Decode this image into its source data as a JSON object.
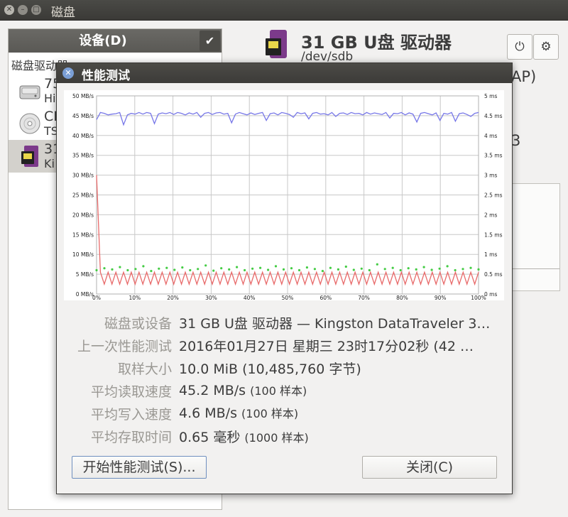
{
  "window": {
    "title": "磁盘"
  },
  "sidebar": {
    "header": "设备(D)",
    "group_label": "磁盘驱动器",
    "items": [
      {
        "name": "75",
        "sub": "Hi",
        "icon": "hard-disk-icon"
      },
      {
        "name": "CI",
        "sub": "TS",
        "icon": "optical-disc-icon"
      },
      {
        "name": "31",
        "sub": "Ki",
        "icon": "usb-drive-icon"
      }
    ]
  },
  "drive": {
    "title": "31 GB U盘 驱动器",
    "path": "/dev/sdb",
    "partial_1": "AP)",
    "partial_2": "3"
  },
  "dialog": {
    "title": "性能测试",
    "rows": [
      {
        "label": "磁盘或设备",
        "value": "31 GB U盘 驱动器 — Kingston DataTraveler 3…",
        "note": ""
      },
      {
        "label": "上一次性能测试",
        "value": "2016年01月27日 星期三 23时17分02秒 (42 …",
        "note": ""
      },
      {
        "label": "取样大小",
        "value": "10.0 MiB (10,485,760 字节)",
        "note": ""
      },
      {
        "label": "平均读取速度",
        "value": "45.2 MB/s",
        "note": "(100 样本)"
      },
      {
        "label": "平均写入速度",
        "value": "4.6 MB/s",
        "note": "(100 样本)"
      },
      {
        "label": "平均存取时间",
        "value": "0.65 毫秒",
        "note": "(1000 样本)"
      }
    ],
    "start_button": "开始性能测试(S)...",
    "close_button": "关闭(C)"
  },
  "chart_data": {
    "type": "line",
    "left_ticks": [
      "0 MB/s",
      "5 MB/s",
      "10 MB/s",
      "15 MB/s",
      "20 MB/s",
      "25 MB/s",
      "30 MB/s",
      "35 MB/s",
      "40 MB/s",
      "45 MB/s",
      "50 MB/s"
    ],
    "right_ticks": [
      "0 ms",
      "0.5 ms",
      "1 ms",
      "1.5 ms",
      "2 ms",
      "2.5 ms",
      "3 ms",
      "3.5 ms",
      "4 ms",
      "4.5 ms",
      "5 ms"
    ],
    "x_ticks": [
      "0%",
      "10%",
      "20%",
      "30%",
      "40%",
      "50%",
      "60%",
      "70%",
      "80%",
      "90%",
      "100%"
    ],
    "ylim_left": [
      0,
      50
    ],
    "ylim_right": [
      0,
      5
    ],
    "xlim": [
      0,
      100
    ],
    "grid": true,
    "colors": {
      "read": "#7777e8",
      "write": "#e86a6a",
      "access": "#44cc44"
    },
    "series": [
      {
        "values": [
          44,
          45.8,
          45.6,
          45.2,
          45.4,
          45.5,
          45.8,
          42.7,
          45.2,
          45.6,
          45.4,
          45.8,
          45.4,
          45.8,
          45.6,
          43.0,
          45.4,
          45.7,
          45.5,
          45.8,
          45.3,
          45.8,
          45.6,
          45.2,
          45.7,
          45.4,
          45.8,
          44.6,
          45.6,
          45.8,
          45.3,
          45.7,
          45.8,
          45.4,
          45.6,
          43.2,
          45.4,
          45.8,
          45.5,
          45.2,
          45.7,
          45.3,
          45.6,
          45.8,
          43.8,
          45.5,
          45.7,
          45.2,
          45.8,
          45.6,
          45.3,
          44.6,
          45.8,
          45.5,
          45.7,
          44.2,
          45.6,
          45.8,
          45.4,
          45.5,
          45.2,
          45.8,
          44.8,
          45.6,
          45.7,
          45.3,
          45.8,
          45.5,
          45.6,
          45.2,
          45.8,
          45.4,
          45.7,
          45.5,
          45.3,
          45.8,
          44.4,
          45.6,
          45.5,
          45.8,
          45.2,
          45.7,
          45.4,
          43.4,
          45.6,
          45.8,
          45.5,
          45.2,
          45.7,
          43.8,
          45.6,
          45.4,
          45.8,
          43.6,
          45.5,
          45.7,
          45.3,
          44.8,
          45.6,
          45.8
        ]
      },
      {
        "values": [
          30,
          5.5,
          2.5,
          5.5,
          2.5,
          5.5,
          2.5,
          5.5,
          2.5,
          5.5,
          2.5,
          5.5,
          2.5,
          5.5,
          2.5,
          5.5,
          2.5,
          5.5,
          2.5,
          5.5,
          2.5,
          5.5,
          2.5,
          5.5,
          2.5,
          5.5,
          2.5,
          5.5,
          2.5,
          5.5,
          2.5,
          5.5,
          2.5,
          5.5,
          2.5,
          5.5,
          2.5,
          5.5,
          2.5,
          5.5,
          2.5,
          5.5,
          2.5,
          5.5,
          2.5,
          5.5,
          2.5,
          5.5,
          2.5,
          5.5,
          2.5,
          5.5,
          2.5,
          5.5,
          2.5,
          5.5,
          2.5,
          5.5,
          2.5,
          5.5,
          2.5,
          5.5,
          2.5,
          5.5,
          2.5,
          5.5,
          2.5,
          5.5,
          2.5,
          5.5,
          2.5,
          5.5,
          2.5,
          5.5,
          2.5,
          5.5,
          2.5,
          5.5,
          2.5,
          5.5,
          2.5,
          5.5,
          2.5,
          5.5,
          2.5,
          5.5,
          2.5,
          5.5,
          2.5,
          5.5,
          2.5,
          5.5,
          2.5,
          5.5,
          2.5,
          5.5,
          2.5,
          5.5,
          2.5,
          5.5
        ]
      },
      {
        "values": [
          0.6,
          0.65,
          0.62,
          0.68,
          0.6,
          0.63,
          0.7,
          0.58,
          0.64,
          0.66,
          0.61,
          0.67,
          0.6,
          0.63,
          0.72,
          0.59,
          0.65,
          0.62,
          0.68,
          0.6,
          0.64,
          0.66,
          0.61,
          0.7,
          0.62,
          0.65,
          0.6,
          0.67,
          0.63,
          0.58,
          0.66,
          0.62,
          0.69,
          0.61,
          0.64,
          0.6,
          0.75,
          0.63,
          0.66,
          0.6,
          0.65,
          0.62,
          0.68,
          0.61,
          0.64,
          0.7,
          0.6,
          0.63,
          0.66,
          0.62
        ]
      }
    ]
  }
}
